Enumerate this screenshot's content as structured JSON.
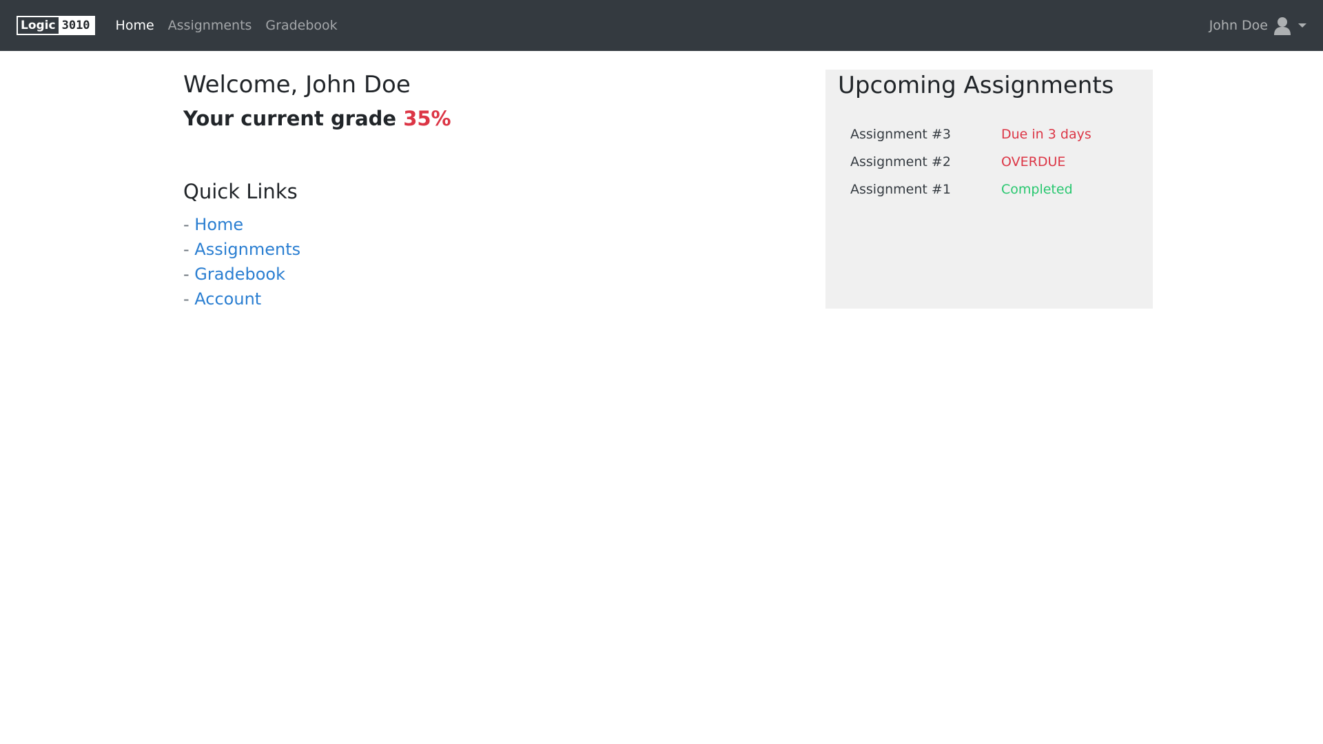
{
  "navbar": {
    "brand_left": "Logic",
    "brand_right": "3010",
    "links": [
      {
        "label": "Home",
        "active": true
      },
      {
        "label": "Assignments",
        "active": false
      },
      {
        "label": "Gradebook",
        "active": false
      }
    ],
    "user_name": "John Doe"
  },
  "main": {
    "welcome": "Welcome, John Doe",
    "grade_label": "Your current grade",
    "grade_value": "35%",
    "quick_links_title": "Quick Links",
    "quick_links": [
      {
        "prefix": "- ",
        "label": "Home"
      },
      {
        "prefix": "- ",
        "label": "Assignments"
      },
      {
        "prefix": "- ",
        "label": "Gradebook"
      },
      {
        "prefix": "- ",
        "label": "Account"
      }
    ]
  },
  "upcoming": {
    "title": "Upcoming Assignments",
    "items": [
      {
        "name": "Assignment #3",
        "status": "Due in 3 days"
      },
      {
        "name": "Assignment #2",
        "status": "OVERDUE"
      },
      {
        "name": "Assignment #1",
        "status": "Completed"
      }
    ]
  },
  "colors": {
    "navbar_bg": "#343a40",
    "link": "#2a7ed1",
    "danger": "#dc3545",
    "success": "#28c76f",
    "panel_bg": "#f0f0f0"
  }
}
